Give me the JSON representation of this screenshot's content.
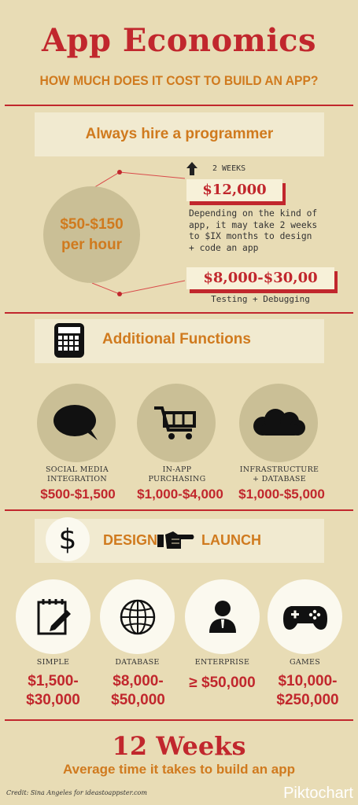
{
  "header": {
    "title": "App Economics",
    "subtitle": "HOW MUCH DOES IT COST TO BUILD AN APP?"
  },
  "programmer": {
    "heading": "Always hire a programmer",
    "rate_line1": "$50-$150",
    "rate_line2": "per hour",
    "duration": "2 WEEKS",
    "price_top": "$12,000",
    "description_lines": [
      "Depending on the kind of",
      "app, it may take 2 weeks",
      "to $IX months to design",
      "+ code an app"
    ],
    "price_bottom": "$8,000-$30,00",
    "bottom_caption": "Testing + Debugging"
  },
  "functions": {
    "heading": "Additional Functions",
    "items": [
      {
        "label_line1": "SOCIAL MEDIA",
        "label_line2": "INTEGRATION",
        "price": "$500-$1,500",
        "icon": "speech-bubble-icon"
      },
      {
        "label_line1": "IN-APP",
        "label_line2": "PURCHASING",
        "price": "$1,000-$4,000",
        "icon": "shopping-cart-icon"
      },
      {
        "label_line1": "INFRASTRUCTURE",
        "label_line2": "+ DATABASE",
        "price": "$1,000-$5,000",
        "icon": "cloud-icon"
      }
    ]
  },
  "design": {
    "left": "DESIGN",
    "right": "LAUNCH",
    "items": [
      {
        "label": "SIMPLE",
        "price_line1": "$1,500-",
        "price_line2": "$30,000",
        "icon": "notepad-icon"
      },
      {
        "label": "DATABASE",
        "price_line1": "$8,000-",
        "price_line2": "$50,000",
        "icon": "globe-icon"
      },
      {
        "label": "ENTERPRISE",
        "price_line1": "≥ $50,000",
        "price_line2": "",
        "icon": "person-icon"
      },
      {
        "label": "GAMES",
        "price_line1": "$10,000-",
        "price_line2": "$250,000",
        "icon": "gamepad-icon"
      }
    ]
  },
  "footer": {
    "weeks": "12 Weeks",
    "caption": "Average time it takes to build an app",
    "credit": "Credit: Sina Angeles for ideastoappster.com",
    "brand": "Piktochart"
  },
  "colors": {
    "background": "#e8dcb5",
    "red": "#c1272d",
    "orange": "#d07a1e",
    "circle": "#cabf96"
  }
}
